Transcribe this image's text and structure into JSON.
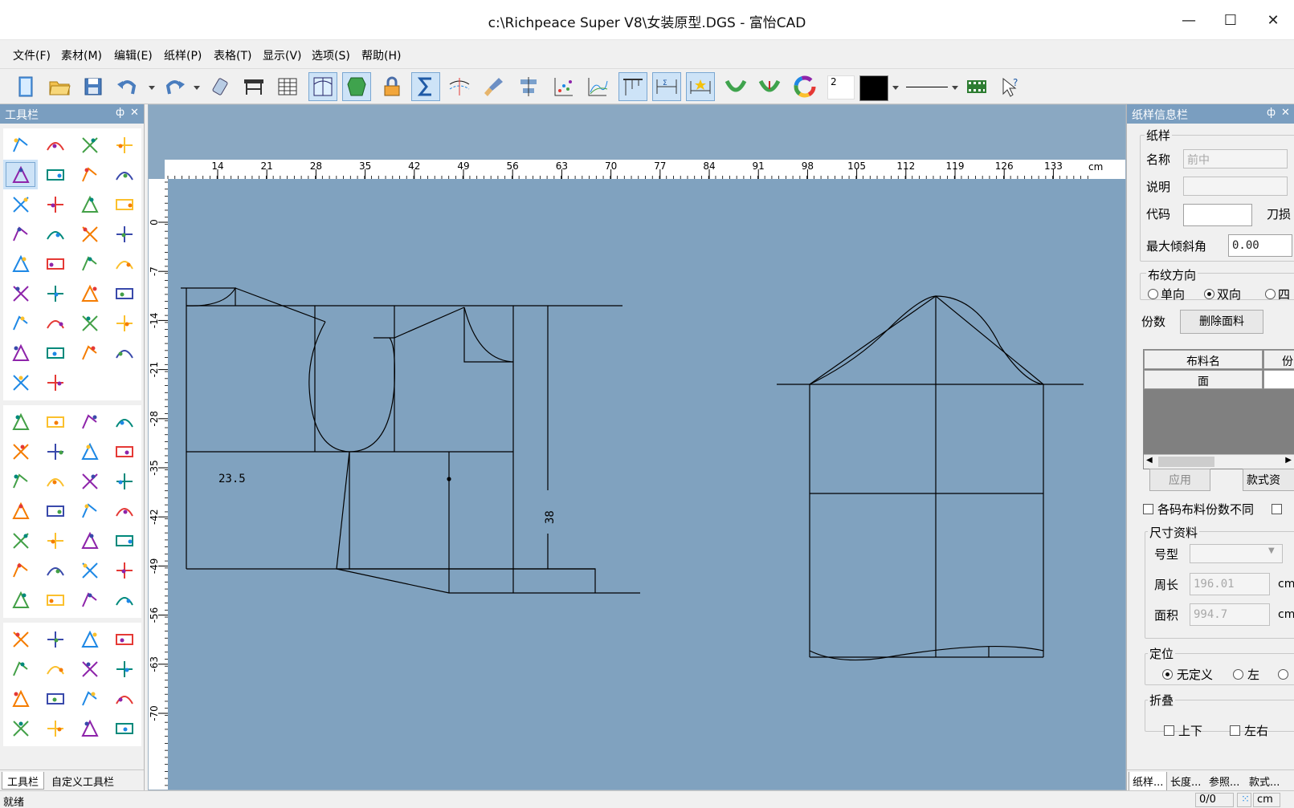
{
  "titlebar": {
    "title": "c:\\Richpeace Super V8\\女装原型.DGS - 富怡CAD",
    "minimize": "—",
    "maximize": "☐",
    "close": "✕"
  },
  "menu": [
    "文件(F)",
    "素材(M)",
    "编辑(E)",
    "纸样(P)",
    "表格(T)",
    "显示(V)",
    "选项(S)",
    "帮助(H)"
  ],
  "toolbar": {
    "line_width_value": "2",
    "active_tools": [
      "grid-view-icon",
      "piece-view-icon",
      "sum-icon",
      "measure-ruler-icon",
      "measure-sigma-icon",
      "measure-star-icon"
    ]
  },
  "left_panel": {
    "title": "工具栏",
    "pin": "ф",
    "close": "✕",
    "tabs": [
      "工具栏",
      "自定义工具栏"
    ]
  },
  "canvas": {
    "ruler_unit": "cm",
    "h_ticks": [
      "14",
      "21",
      "28",
      "35",
      "42",
      "49",
      "56",
      "63",
      "70",
      "77",
      "84",
      "91",
      "98",
      "105",
      "112",
      "119",
      "126",
      "133"
    ],
    "v_ticks": [
      "0",
      "-7",
      "-14",
      "-21",
      "-28",
      "-35",
      "-42",
      "-49",
      "-56",
      "-63",
      "-70"
    ],
    "label_a": "23.5",
    "label_b": "38"
  },
  "right_panel": {
    "title": "纸样信息栏",
    "pin": "ф",
    "close": "✕",
    "group_pattern": "纸样",
    "name_label": "名称",
    "name_value": "前中",
    "desc_label": "说明",
    "desc_value": "",
    "code_label": "代码",
    "code_value": "",
    "notch_label": "刀损",
    "max_tilt_label": "最大倾斜角",
    "max_tilt_value": "0.00",
    "grain_group": "布纹方向",
    "grain_options": [
      "单向",
      "双向",
      "四"
    ],
    "grain_selected": "双向",
    "copies_label": "份数",
    "delete_fabric_btn": "删除面料",
    "fabric_col_name": "布料名",
    "fabric_col_copies": "份",
    "fabric_row_name": "面",
    "apply_btn": "应用",
    "style_btn": "款式资",
    "per_size_label": "各码布料份数不同",
    "size_group": "尺寸资料",
    "size_type_label": "号型",
    "size_type_value": "",
    "perimeter_label": "周长",
    "perimeter_value": "196.01",
    "area_label": "面积",
    "area_value": "994.7",
    "unit_cm": "cm",
    "position_group": "定位",
    "position_options": [
      "无定义",
      "左"
    ],
    "position_selected": "无定义",
    "fold_group": "折叠",
    "fold_options": [
      "上下",
      "左右"
    ],
    "tabs": [
      "纸样...",
      "长度...",
      "参照...",
      "款式..."
    ]
  },
  "statusbar": {
    "status": "就绪",
    "count": "0/0",
    "unit": "cm"
  },
  "colors": {
    "canvas_bg": "#8aa8c2",
    "panel_head": "#7a9ec0",
    "active_btn": "#cde3f7"
  }
}
